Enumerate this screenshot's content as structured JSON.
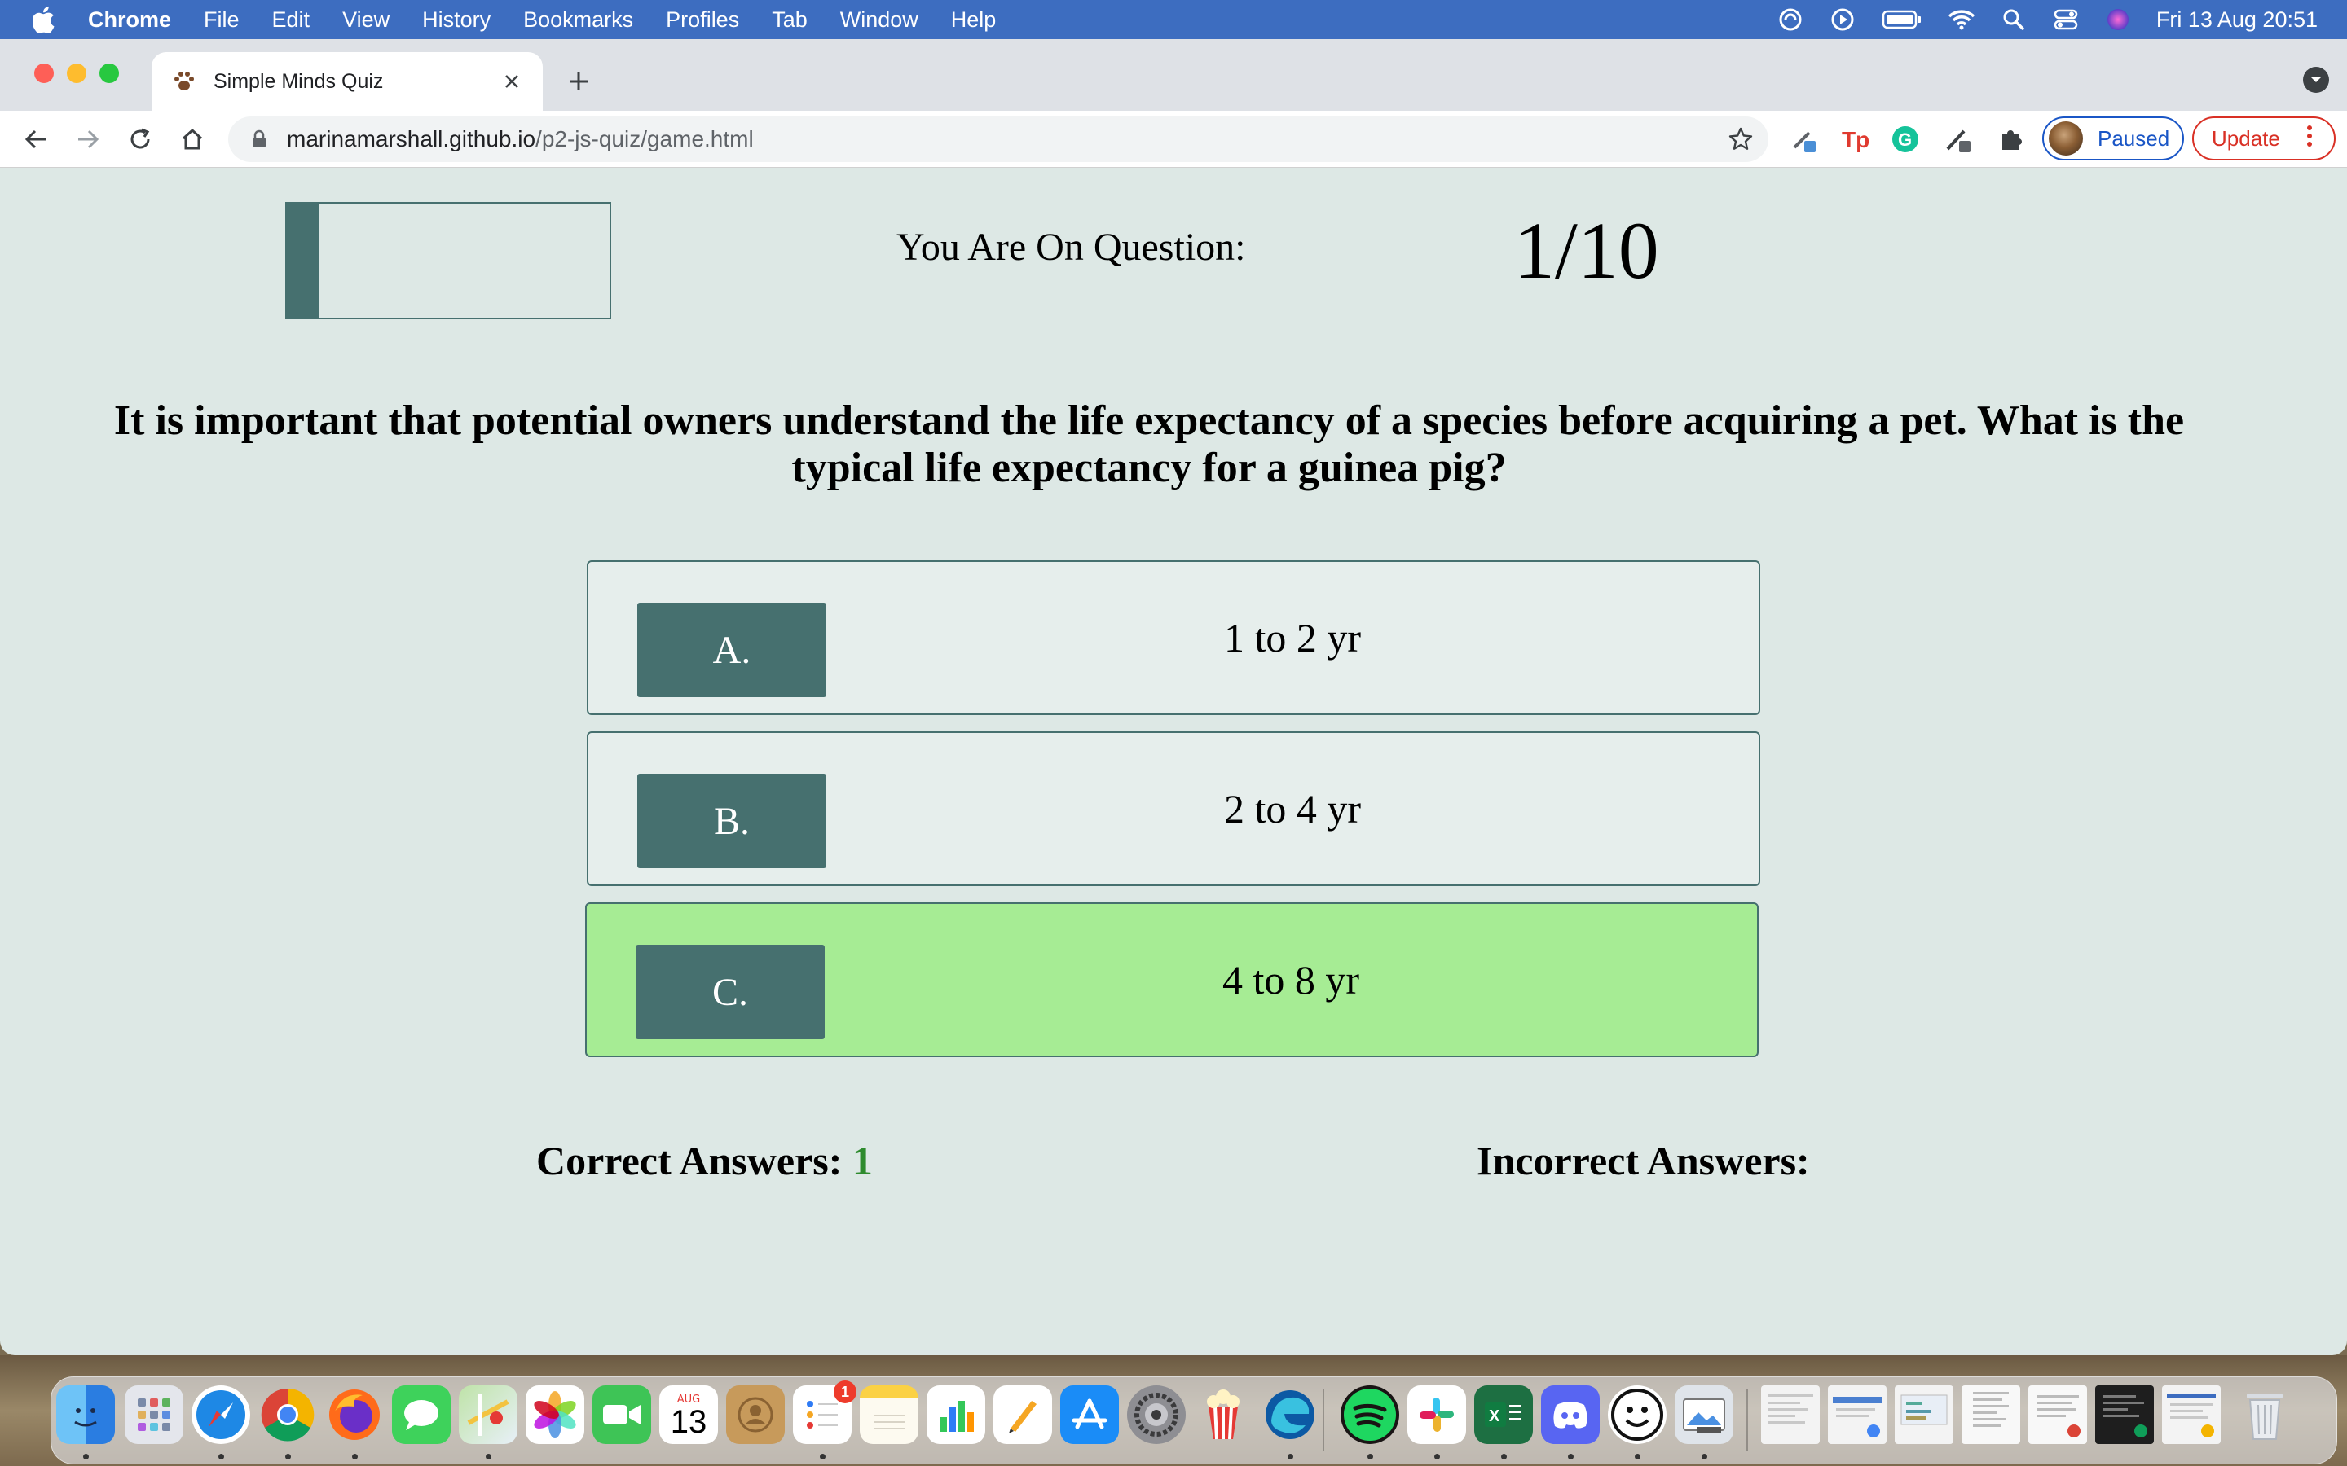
{
  "menubar": {
    "items": [
      "Chrome",
      "File",
      "Edit",
      "View",
      "History",
      "Bookmarks",
      "Profiles",
      "Tab",
      "Window",
      "Help"
    ],
    "datetime": "Fri 13 Aug  20:51"
  },
  "browser": {
    "tab_title": "Simple Minds Quiz",
    "url_domain": "marinamarshall.github.io",
    "url_path": "/p2-js-quiz/game.html",
    "profile_label": "Paused",
    "update_label": "Update",
    "accent": "#1a56c6",
    "update_color": "#d93025"
  },
  "quiz": {
    "progress_fraction": 0.1,
    "question_label": "You Are On Question:",
    "question_counter": "1/10",
    "question_text": "It is important that potential owners understand the life expectancy of a species before acquiring a pet. What is the typical life expectancy for a guinea pig?",
    "answers": [
      {
        "letter": "A.",
        "text": "1 to 2 yr",
        "state": "default"
      },
      {
        "letter": "B.",
        "text": "2 to 4 yr",
        "state": "default"
      },
      {
        "letter": "C.",
        "text": "4 to 8 yr",
        "state": "correct"
      }
    ],
    "correct_label": "Correct Answers:",
    "correct_count": "1",
    "incorrect_label": "Incorrect Answers:",
    "incorrect_count": "",
    "theme_color": "#46706f",
    "correct_color": "#a6ec94"
  },
  "dock": {
    "apps": [
      "finder-icon",
      "launchpad-icon",
      "safari-icon",
      "chrome-icon",
      "firefox-icon",
      "messages-icon",
      "maps-icon",
      "photos-icon",
      "facetime-icon",
      "calendar-icon",
      "contacts-icon",
      "reminders-icon",
      "notes-icon",
      "numbers-icon",
      "pages-icon",
      "app-store-icon",
      "system-preferences-icon",
      "popcorn-time-icon",
      "edge-icon",
      "spotify-icon",
      "slack-icon",
      "excel-icon",
      "discord-icon",
      "smiley-app-icon",
      "preview-icon"
    ],
    "calendar_month": "AUG",
    "calendar_day": "13",
    "reminders_badge": "1"
  }
}
